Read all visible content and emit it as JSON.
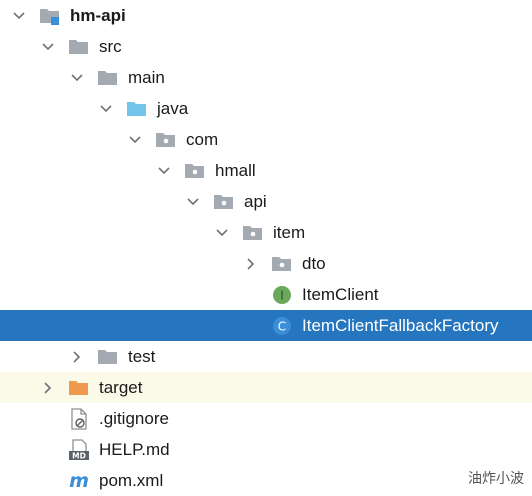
{
  "colors": {
    "selection": "#2675bf",
    "excluded_row": "#fbf9e8",
    "folder_gray": "#a4aab1",
    "folder_source": "#72c4ea",
    "folder_excluded": "#f09a4f",
    "interface_green": "#6aa95c",
    "class_blue": "#3b8ed8",
    "module_accent": "#3b8ed8"
  },
  "tree": {
    "items": [
      {
        "label": "hm-api",
        "depth": 0,
        "chevron": "down",
        "icon": "module-folder-icon",
        "bold": true
      },
      {
        "label": "src",
        "depth": 1,
        "chevron": "down",
        "icon": "folder-icon"
      },
      {
        "label": "main",
        "depth": 2,
        "chevron": "down",
        "icon": "folder-icon"
      },
      {
        "label": "java",
        "depth": 3,
        "chevron": "down",
        "icon": "source-folder-icon"
      },
      {
        "label": "com",
        "depth": 4,
        "chevron": "down",
        "icon": "package-icon"
      },
      {
        "label": "hmall",
        "depth": 5,
        "chevron": "down",
        "icon": "package-icon"
      },
      {
        "label": "api",
        "depth": 6,
        "chevron": "down",
        "icon": "package-icon"
      },
      {
        "label": "item",
        "depth": 7,
        "chevron": "down",
        "icon": "package-icon"
      },
      {
        "label": "dto",
        "depth": 8,
        "chevron": "right",
        "icon": "package-icon"
      },
      {
        "label": "ItemClient",
        "depth": 8,
        "chevron": "none",
        "icon": "interface-icon"
      },
      {
        "label": "ItemClientFallbackFactory",
        "depth": 8,
        "chevron": "none",
        "icon": "class-icon",
        "selected": true
      },
      {
        "label": "test",
        "depth": 2,
        "chevron": "right",
        "icon": "folder-icon"
      },
      {
        "label": "target",
        "depth": 1,
        "chevron": "right",
        "icon": "excluded-folder-icon",
        "excluded": true
      },
      {
        "label": ".gitignore",
        "depth": 1,
        "chevron": "none",
        "icon": "gitignore-file-icon"
      },
      {
        "label": "HELP.md",
        "depth": 1,
        "chevron": "none",
        "icon": "markdown-file-icon"
      },
      {
        "label": "pom.xml",
        "depth": 1,
        "chevron": "none",
        "icon": "maven-pom-icon"
      }
    ]
  },
  "watermark": "油炸小波"
}
